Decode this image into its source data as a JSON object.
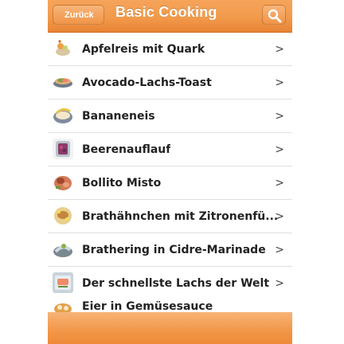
{
  "navbar": {
    "back_label": "Zurück",
    "title": "Basic Cooking",
    "search_icon": "search-icon"
  },
  "colors": {
    "accent": "#F29A4B",
    "accent_dark": "#E88435"
  },
  "recipes": [
    {
      "label": "Apfelreis mit Quark",
      "icon": "recipe-thumbnail"
    },
    {
      "label": "Avocado-Lachs-Toast",
      "icon": "recipe-thumbnail"
    },
    {
      "label": "Bananeneis",
      "icon": "recipe-thumbnail"
    },
    {
      "label": "Beerenauflauf",
      "icon": "recipe-thumbnail"
    },
    {
      "label": "Bollito Misto",
      "icon": "recipe-thumbnail"
    },
    {
      "label": "Brathähnchen mit Zitronenfü...",
      "icon": "recipe-thumbnail"
    },
    {
      "label": "Brathering in Cidre-Marinade",
      "icon": "recipe-thumbnail"
    },
    {
      "label": "Der schnellste Lachs der Welt",
      "icon": "recipe-thumbnail"
    },
    {
      "label": "Eier in Gemüsesauce",
      "icon": "recipe-thumbnail"
    }
  ],
  "chevron": ">"
}
